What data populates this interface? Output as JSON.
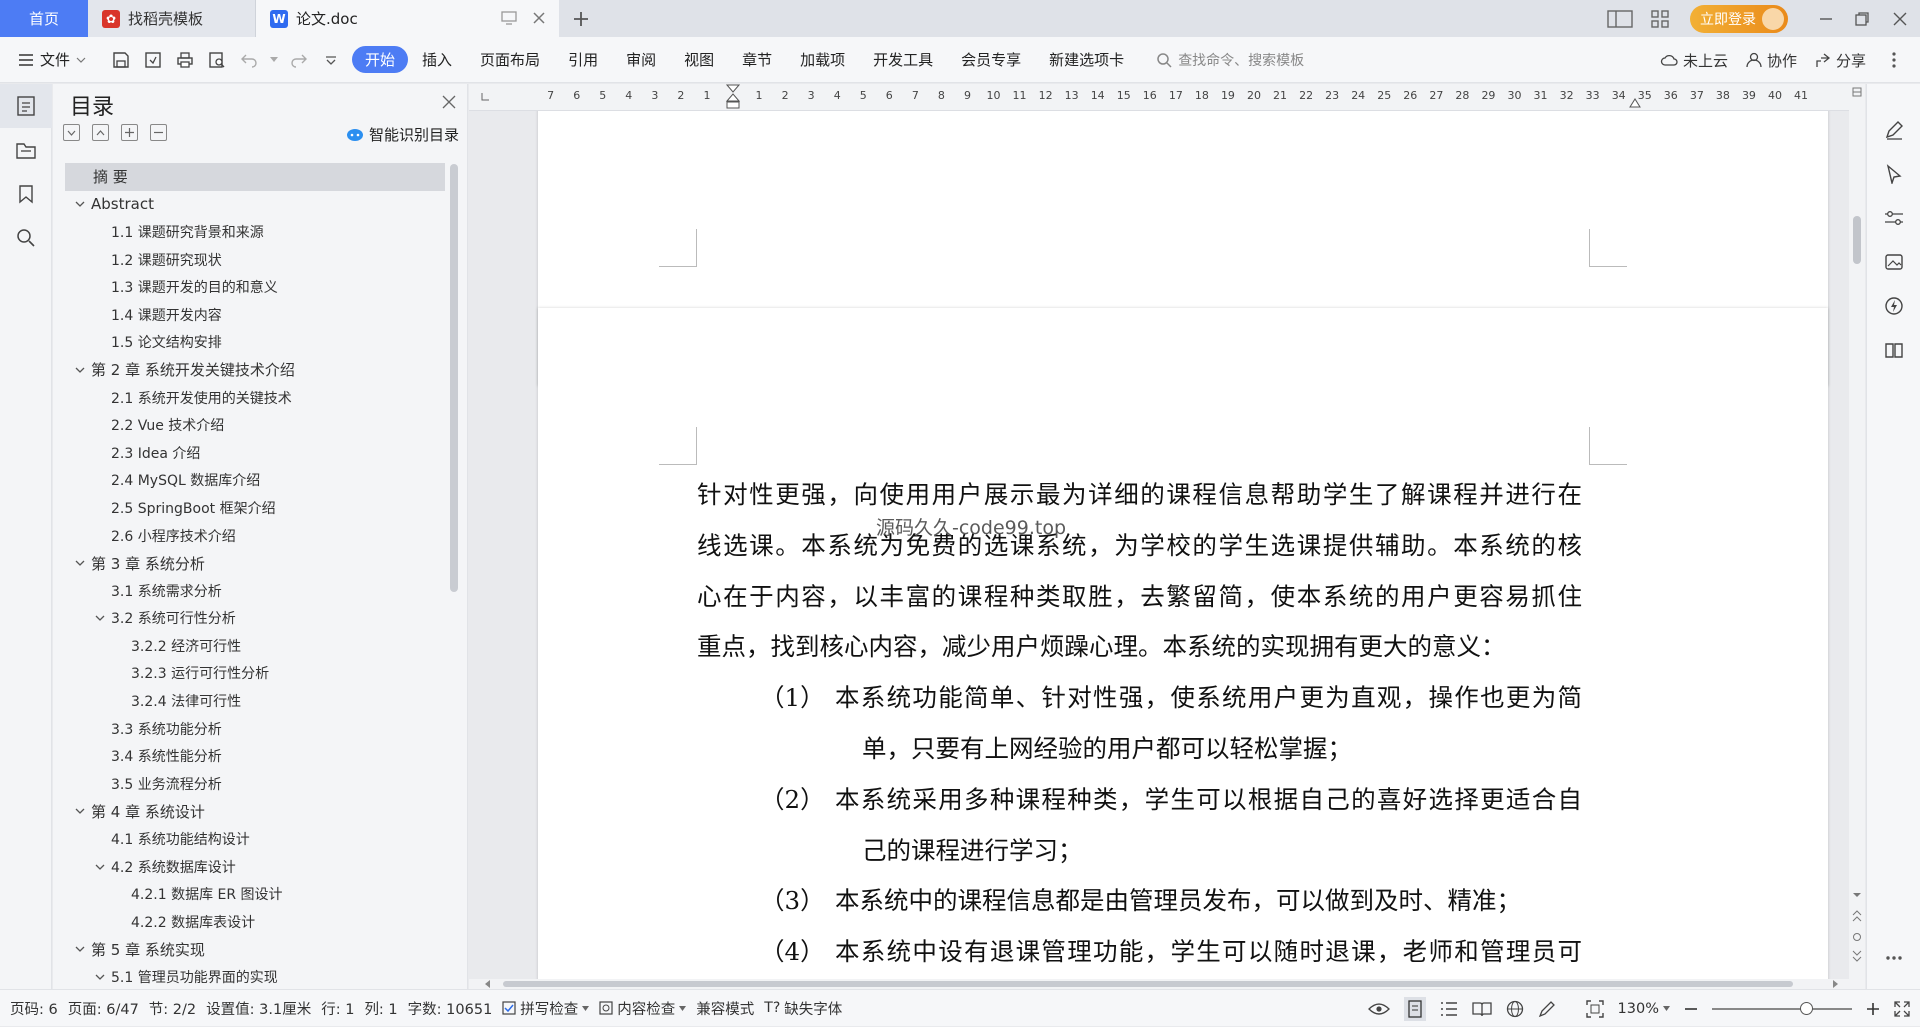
{
  "titlebar": {
    "home_tab": "首页",
    "tabs": [
      {
        "label": "找稻壳模板",
        "icon": "docer-icon"
      },
      {
        "label": "论文.doc",
        "icon": "wps-writer-icon"
      }
    ],
    "login_label": "立即登录"
  },
  "ribbon": {
    "file_label": "文件",
    "tabs": [
      "开始",
      "插入",
      "页面布局",
      "引用",
      "审阅",
      "视图",
      "章节",
      "加载项",
      "开发工具",
      "会员专享",
      "新建选项卡"
    ],
    "active_tab": "开始",
    "search_placeholder": "查找命令、搜索模板",
    "cloud_label": "未上云",
    "collab_label": "协作",
    "share_label": "分享"
  },
  "toc": {
    "title": "目录",
    "smart_label": "智能识别目录",
    "items": [
      {
        "label": "摘  要",
        "level": 1,
        "caret": "none",
        "selected": true
      },
      {
        "label": "Abstract",
        "level": 1,
        "caret": "down"
      },
      {
        "label": "1.1 课题研究背景和来源",
        "level": 2
      },
      {
        "label": "1.2 课题研究现状",
        "level": 2
      },
      {
        "label": "1.3 课题开发的目的和意义",
        "level": 2
      },
      {
        "label": "1.4 课题开发内容",
        "level": 2
      },
      {
        "label": "1.5 论文结构安排",
        "level": 2
      },
      {
        "label": "第 2 章  系统开发关键技术介绍",
        "level": 1,
        "caret": "down"
      },
      {
        "label": "2.1 系统开发使用的关键技术",
        "level": 2
      },
      {
        "label": "2.2 Vue 技术介绍",
        "level": 2
      },
      {
        "label": "2.3 Idea 介绍",
        "level": 2
      },
      {
        "label": "2.4 MySQL 数据库介绍",
        "level": 2
      },
      {
        "label": "2.5 SpringBoot 框架介绍",
        "level": 2
      },
      {
        "label": "2.6 小程序技术介绍",
        "level": 2
      },
      {
        "label": "第 3 章  系统分析",
        "level": 1,
        "caret": "down"
      },
      {
        "label": "3.1 系统需求分析",
        "level": 2
      },
      {
        "label": "3.2 系统可行性分析",
        "level": 2,
        "caret": "down"
      },
      {
        "label": "3.2.2 经济可行性",
        "level": 3
      },
      {
        "label": "3.2.3 运行可行性分析",
        "level": 3
      },
      {
        "label": "3.2.4 法律可行性",
        "level": 3
      },
      {
        "label": "3.3 系统功能分析",
        "level": 2
      },
      {
        "label": "3.4 系统性能分析",
        "level": 2
      },
      {
        "label": "3.5 业务流程分析",
        "level": 2
      },
      {
        "label": "第 4 章  系统设计",
        "level": 1,
        "caret": "down"
      },
      {
        "label": "4.1 系统功能结构设计",
        "level": 2
      },
      {
        "label": "4.2 系统数据库设计",
        "level": 2,
        "caret": "down"
      },
      {
        "label": "4.2.1 数据库 ER 图设计",
        "level": 3
      },
      {
        "label": "4.2.2 数据库表设计",
        "level": 3
      },
      {
        "label": "第 5 章  系统实现",
        "level": 1,
        "caret": "down"
      },
      {
        "label": "5.1 管理员功能界面的实现",
        "level": 2,
        "caret": "down"
      }
    ]
  },
  "ruler": {
    "left_ticks": [
      "7",
      "6",
      "5",
      "4",
      "3",
      "2",
      "1"
    ],
    "right_ticks": [
      "1",
      "2",
      "3",
      "4",
      "5",
      "6",
      "7",
      "8",
      "9",
      "10",
      "11",
      "12",
      "13",
      "14",
      "15",
      "16",
      "17",
      "18",
      "19",
      "20",
      "21",
      "22",
      "23",
      "24",
      "25",
      "26",
      "27",
      "28",
      "29",
      "30",
      "31",
      "32",
      "33",
      "34",
      "35",
      "36",
      "37",
      "38",
      "39",
      "40",
      "41"
    ]
  },
  "document": {
    "watermark": "源码久久-code99.top",
    "para_lines": [
      "针对性更强，向使用用户展示最为详细的课程信息帮助学生了解课程并进行在",
      "线选课。本系统为免费的选课系统，为学校的学生选课提供辅助。本系统的核",
      "心在于内容，以丰富的课程种类取胜，去繁留简，使本系统的用户更容易抓住",
      "重点，找到核心内容，减少用户烦躁心理。本系统的实现拥有更大的意义："
    ],
    "list": [
      {
        "num": "（1）",
        "l1": "本系统功能简单、针对性强，使系统用户更为直观，操作也更为简",
        "l2": "单，只要有上网经验的用户都可以轻松掌握；"
      },
      {
        "num": "（2）",
        "l1": "本系统采用多种课程种类，学生可以根据自己的喜好选择更适合自",
        "l2": "己的课程进行学习；"
      },
      {
        "num": "（3）",
        "l1": "本系统中的课程信息都是由管理员发布，可以做到及时、精准；",
        "l2": ""
      },
      {
        "num": "（4）",
        "l1": "本系统中设有退课管理功能，学生可以随时退课，老师和管理员可",
        "l2": ""
      }
    ]
  },
  "status": {
    "page_no": "页码: 6",
    "page": "页面: 6/47",
    "section": "节: 2/2",
    "setting": "设置值: 3.1厘米",
    "row": "行: 1",
    "col": "列: 1",
    "words": "字数: 10651",
    "spell": "拼写检查",
    "content": "内容检查",
    "compat": "兼容模式",
    "missing_font": "缺失字体",
    "zoom": "130%"
  },
  "colors": {
    "accent": "#4d7cf4",
    "login": "#ef9a22"
  }
}
